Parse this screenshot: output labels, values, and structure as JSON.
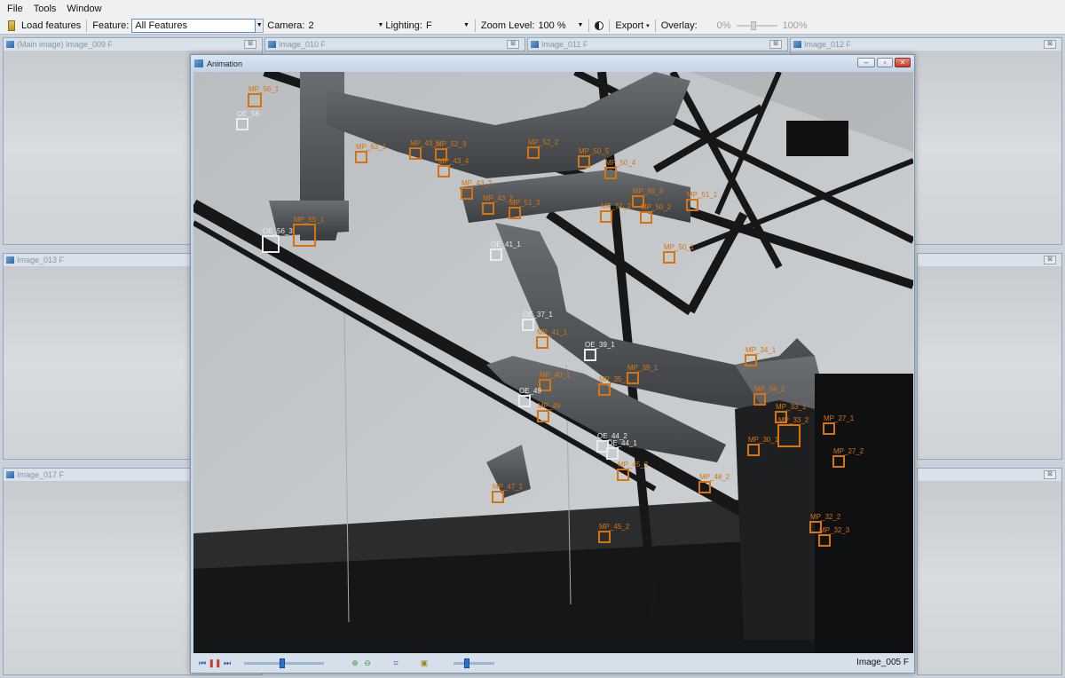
{
  "menu": [
    "File",
    "Tools",
    "Window"
  ],
  "toolbar": {
    "load_label": "Load features",
    "feature_label": "Feature:",
    "feature_value": "All Features",
    "camera_label": "Camera:",
    "camera_value": "2",
    "lighting_label": "Lighting:",
    "lighting_value": "F",
    "zoom_label": "Zoom Level:",
    "zoom_value": "100 %",
    "export_label": "Export",
    "overlay_label": "Overlay:",
    "overlay_min": "0%",
    "overlay_max": "100%",
    "overlay_value_percent": 40
  },
  "panes": {
    "p009": "(Main image) Image_009 F",
    "p010": "Image_010 F",
    "p011": "Image_011 F",
    "p012": "Image_012 F",
    "p013": "Image_013 F",
    "p017": "Image_017 F"
  },
  "animation": {
    "title": "Animation",
    "frame_label": "Image_005 F",
    "seek_position_percent": 48,
    "speed_position_percent": 30
  },
  "markers": [
    {
      "label": "MP_56_1",
      "kind": "mp"
    },
    {
      "label": "OE_56",
      "kind": "oe"
    },
    {
      "label": "MP_63_1",
      "kind": "mp"
    },
    {
      "label": "MP_43_5",
      "kind": "mp"
    },
    {
      "label": "MP_52_3",
      "kind": "mp"
    },
    {
      "label": "MP_43_4",
      "kind": "mp"
    },
    {
      "label": "MP_52_2",
      "kind": "mp"
    },
    {
      "label": "MP_50_5",
      "kind": "mp"
    },
    {
      "label": "MP_50_4",
      "kind": "mp"
    },
    {
      "label": "MP_43_3",
      "kind": "mp"
    },
    {
      "label": "MP_50_3",
      "kind": "mp"
    },
    {
      "label": "MP_51_1",
      "kind": "mp"
    },
    {
      "label": "MP_43_2",
      "kind": "mp"
    },
    {
      "label": "MP_51_3",
      "kind": "mp"
    },
    {
      "label": "MP_51_2",
      "kind": "mp"
    },
    {
      "label": "MP_50_2",
      "kind": "mp"
    },
    {
      "label": "MP_55_1",
      "kind": "mp"
    },
    {
      "label": "OE_56_3",
      "kind": "oe"
    },
    {
      "label": "OE_41_1",
      "kind": "oe"
    },
    {
      "label": "MP_50_1",
      "kind": "mp"
    },
    {
      "label": "OE_37_1",
      "kind": "oe"
    },
    {
      "label": "MP_41_1",
      "kind": "mp"
    },
    {
      "label": "MP_40_1",
      "kind": "mp"
    },
    {
      "label": "OE_39_1",
      "kind": "oe"
    },
    {
      "label": "MP_39_1",
      "kind": "mp"
    },
    {
      "label": "OE_49",
      "kind": "oe"
    },
    {
      "label": "MP_49",
      "kind": "mp"
    },
    {
      "label": "MP_35_1",
      "kind": "mp"
    },
    {
      "label": "OE_44_2",
      "kind": "oe"
    },
    {
      "label": "OE_44_1",
      "kind": "oe"
    },
    {
      "label": "MP_45_3",
      "kind": "mp"
    },
    {
      "label": "MP_34_1",
      "kind": "mp"
    },
    {
      "label": "MP_34_2",
      "kind": "mp"
    },
    {
      "label": "MP_33_1",
      "kind": "mp"
    },
    {
      "label": "MP_33_2",
      "kind": "mp"
    },
    {
      "label": "MP_27_1",
      "kind": "mp"
    },
    {
      "label": "MP_27_2",
      "kind": "mp"
    },
    {
      "label": "MP_30_1",
      "kind": "mp"
    },
    {
      "label": "MP_48_2",
      "kind": "mp"
    },
    {
      "label": "MP_47_1",
      "kind": "mp"
    },
    {
      "label": "MP_45_2",
      "kind": "mp"
    },
    {
      "label": "MP_32_2",
      "kind": "mp"
    },
    {
      "label": "MP_32_3",
      "kind": "mp"
    }
  ]
}
